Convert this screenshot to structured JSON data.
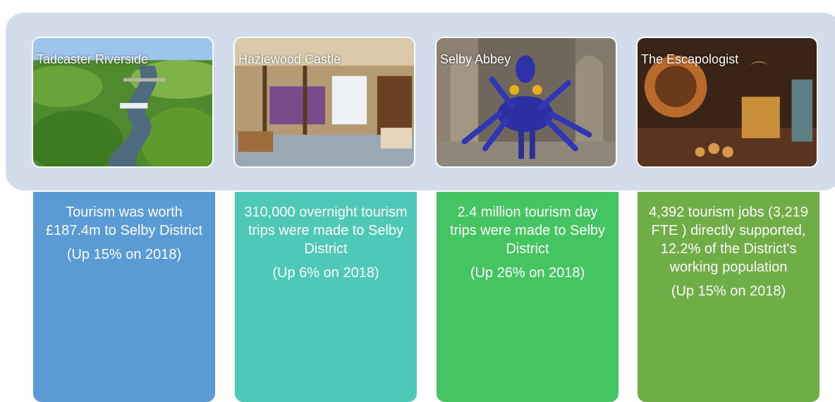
{
  "colors": {
    "band": "#d3dcea",
    "card_1": "#5b9bd5",
    "card_2": "#4fc9b7",
    "card_3": "#45c462",
    "card_4": "#6fad46"
  },
  "photos": [
    {
      "caption": "Tadcaster Riverside"
    },
    {
      "caption": "Hazlewood Castle"
    },
    {
      "caption": "Selby Abbey"
    },
    {
      "caption": "The Escapologist"
    }
  ],
  "cards": [
    {
      "text": "Tourism was worth £187.4m to Selby District",
      "note": "(Up 15% on 2018)"
    },
    {
      "text": "310,000 overnight tourism trips were made to Selby District",
      "note": "(Up 6% on 2018)"
    },
    {
      "text": "2.4 million tourism day trips were made to Selby District",
      "note": "(Up 26% on 2018)"
    },
    {
      "text": "4,392 tourism jobs (3,219 FTE ) directly supported, 12.2% of the District's working population",
      "note": "(Up 15% on 2018)"
    }
  ]
}
